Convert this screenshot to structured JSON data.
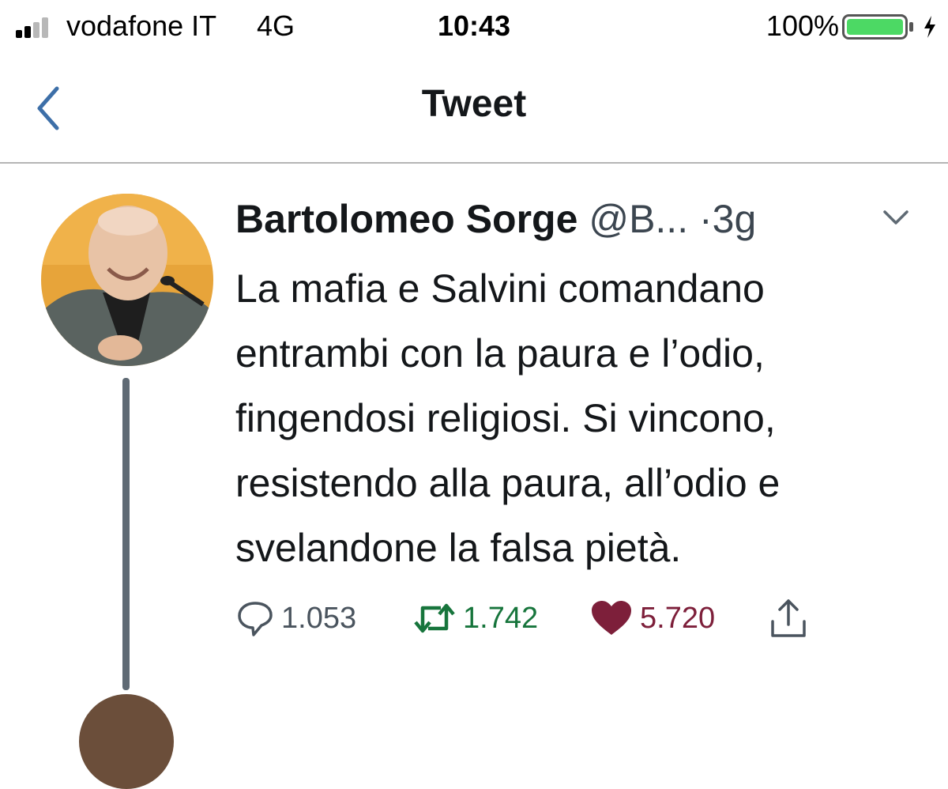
{
  "status_bar": {
    "carrier": "vodafone IT",
    "network": "4G",
    "time": "10:43",
    "battery": "100%",
    "icons": [
      "signal-icon",
      "battery-icon",
      "charging-bolt-icon"
    ]
  },
  "nav": {
    "title": "Tweet",
    "back_icon": "chevron-left-icon"
  },
  "tweet": {
    "author": "Bartolomeo Sorge",
    "handle": "@B...",
    "separator": "·",
    "age": "3g",
    "text": "La mafia e Salvini comandano\nentrambi con la paura e l’odio,\nfingendosi religiosi. Si vincono,\nresistendo alla paura, all’odio e\nsvelandone la falsa pietà.",
    "actions": {
      "replies": "1.053",
      "retweets": "1.742",
      "likes": "5.720"
    },
    "liked": true
  },
  "colors": {
    "retweet": "#17753c",
    "like": "#7d1f3a",
    "link_blue": "#3d6fa8",
    "battery": "#4cd964"
  }
}
